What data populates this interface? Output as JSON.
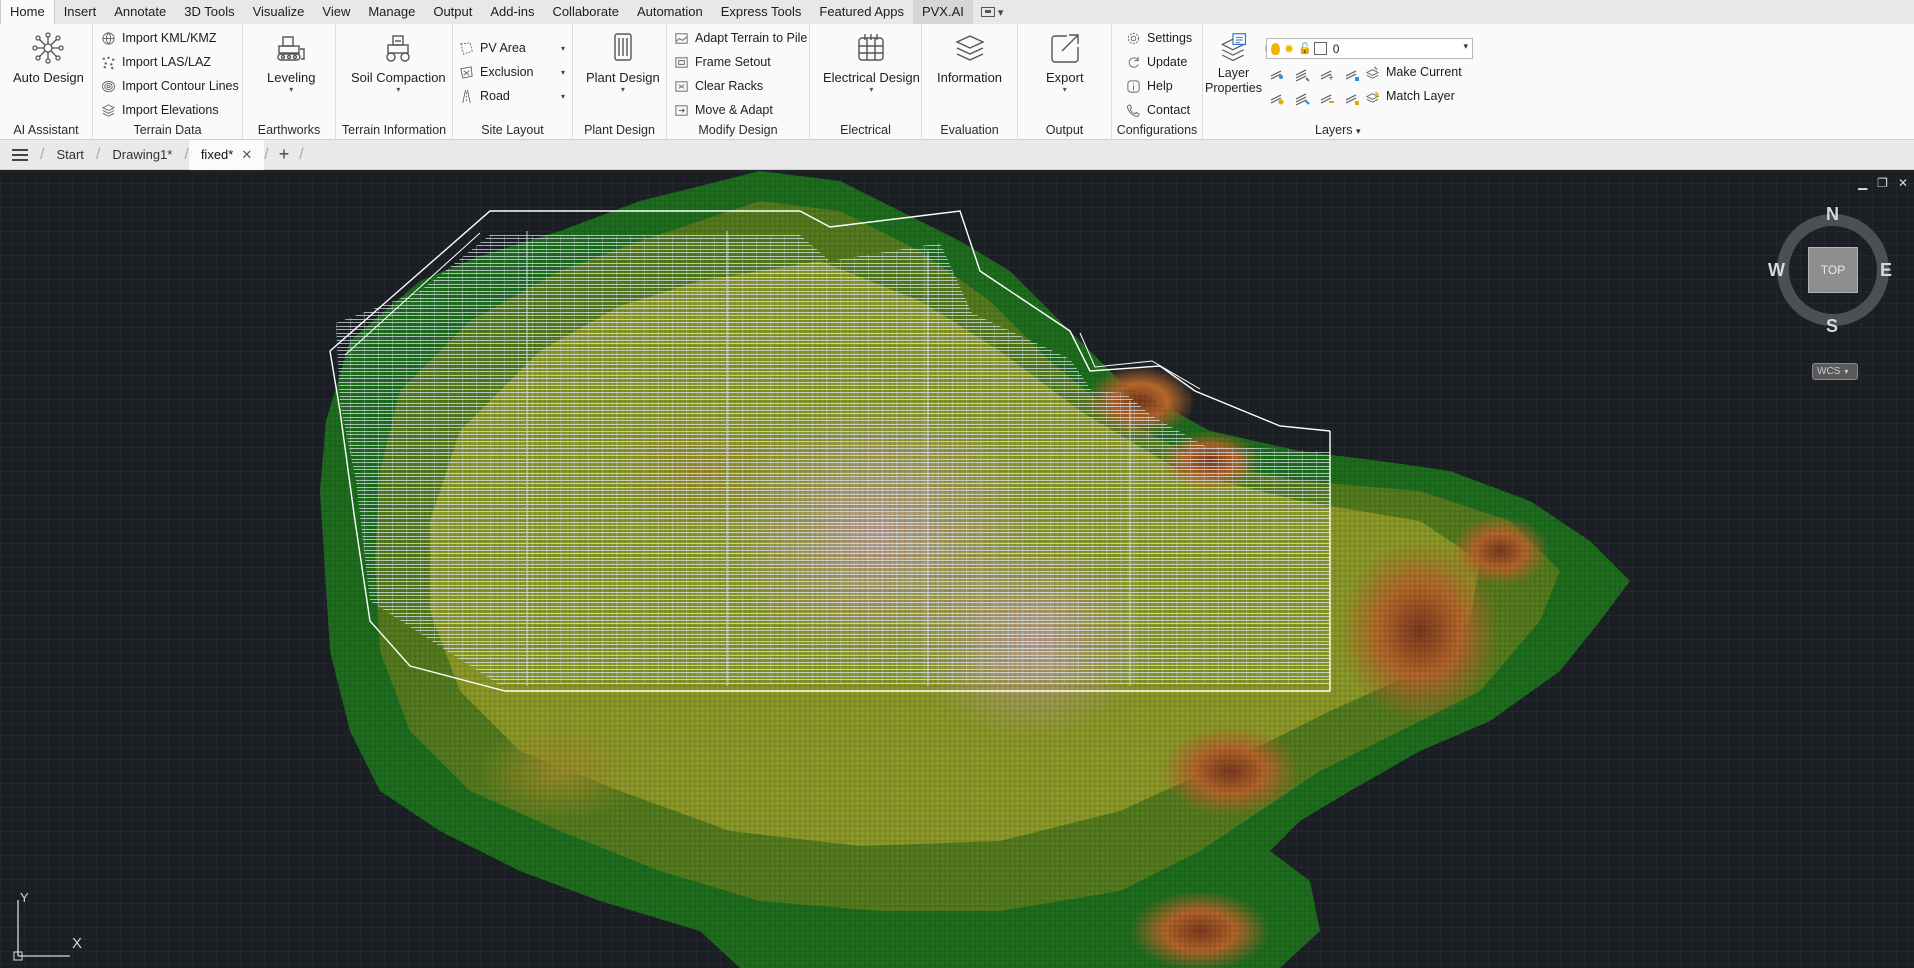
{
  "menu": {
    "tabs": [
      "Home",
      "Insert",
      "Annotate",
      "3D Tools",
      "Visualize",
      "View",
      "Manage",
      "Output",
      "Add-ins",
      "Collaborate",
      "Automation",
      "Express Tools",
      "Featured Apps",
      "PVX.AI"
    ],
    "active": "Home"
  },
  "ribbon": {
    "ai_assistant": {
      "title": "AI Assistant",
      "auto_design": "Auto Design"
    },
    "terrain_data": {
      "title": "Terrain Data",
      "import_kml": "Import KML/KMZ",
      "import_las": "Import LAS/LAZ",
      "import_contour": "Import Contour Lines",
      "import_elevations": "Import Elevations"
    },
    "earthworks": {
      "title": "Earthworks",
      "leveling": "Leveling"
    },
    "terrain_information": {
      "title": "Terrain Information",
      "soil_compaction": "Soil Compaction"
    },
    "site_layout": {
      "title": "Site Layout",
      "pv_area": "PV Area",
      "exclusion": "Exclusion",
      "road": "Road"
    },
    "plant_design": {
      "title": "Plant Design",
      "plant_design": "Plant Design"
    },
    "modify_design": {
      "title": "Modify Design",
      "adapt_terrain": "Adapt Terrain to Pile",
      "frame_setout": "Frame Setout",
      "clear_racks": "Clear Racks",
      "move_adapt": "Move & Adapt"
    },
    "electrical": {
      "title": "Electrical",
      "electrical_design": "Electrical Design"
    },
    "evaluation": {
      "title": "Evaluation",
      "information": "Information"
    },
    "output": {
      "title": "Output",
      "export": "Export"
    },
    "configurations": {
      "title": "Configurations",
      "settings": "Settings",
      "update": "Update",
      "help": "Help",
      "contact": "Contact"
    },
    "layers": {
      "title": "Layers",
      "layer_properties_1": "Layer",
      "layer_properties_2": "Properties",
      "current_layer": "0",
      "make_current": "Make Current",
      "match_layer": "Match Layer"
    }
  },
  "docbar": {
    "tabs": [
      "Start",
      "Drawing1*",
      "fixed*"
    ],
    "active": "fixed*"
  },
  "viewport": {
    "viewcube": {
      "n": "N",
      "s": "S",
      "e": "E",
      "w": "W",
      "face": "TOP",
      "wcs": "WCS"
    },
    "ucs": {
      "x": "X",
      "y": "Y"
    }
  },
  "colors": {
    "background": "#1b1e23",
    "terrain_low": "#1f6e1f",
    "terrain_mid": "#8c9a28",
    "terrain_high": "#b35a2a",
    "pv_boundary": "#ffffff",
    "panel_rows": "#dfe8f0"
  }
}
